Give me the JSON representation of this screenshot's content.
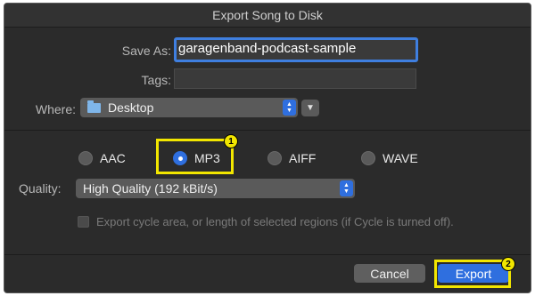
{
  "window": {
    "title": "Export Song to Disk"
  },
  "form": {
    "save_as_label": "Save As:",
    "save_as_value": "garagenband-podcast-sample",
    "tags_label": "Tags:",
    "tags_value": "",
    "where_label": "Where:",
    "where_value": "Desktop",
    "where_icon": "folder-icon"
  },
  "formats": {
    "options": [
      "AAC",
      "MP3",
      "AIFF",
      "WAVE"
    ],
    "selected": "MP3"
  },
  "quality": {
    "label": "Quality:",
    "value": "High Quality (192 kBit/s)"
  },
  "cycle_option": {
    "label": "Export cycle area, or length of selected regions (if Cycle is turned off).",
    "checked": false,
    "enabled": false
  },
  "buttons": {
    "cancel": "Cancel",
    "export": "Export"
  },
  "annotations": {
    "badge_1": "1",
    "badge_2": "2",
    "highlight_color": "#f2e600"
  },
  "colors": {
    "accent": "#2f6fdf",
    "dialog_bg": "#2b2b2b"
  }
}
